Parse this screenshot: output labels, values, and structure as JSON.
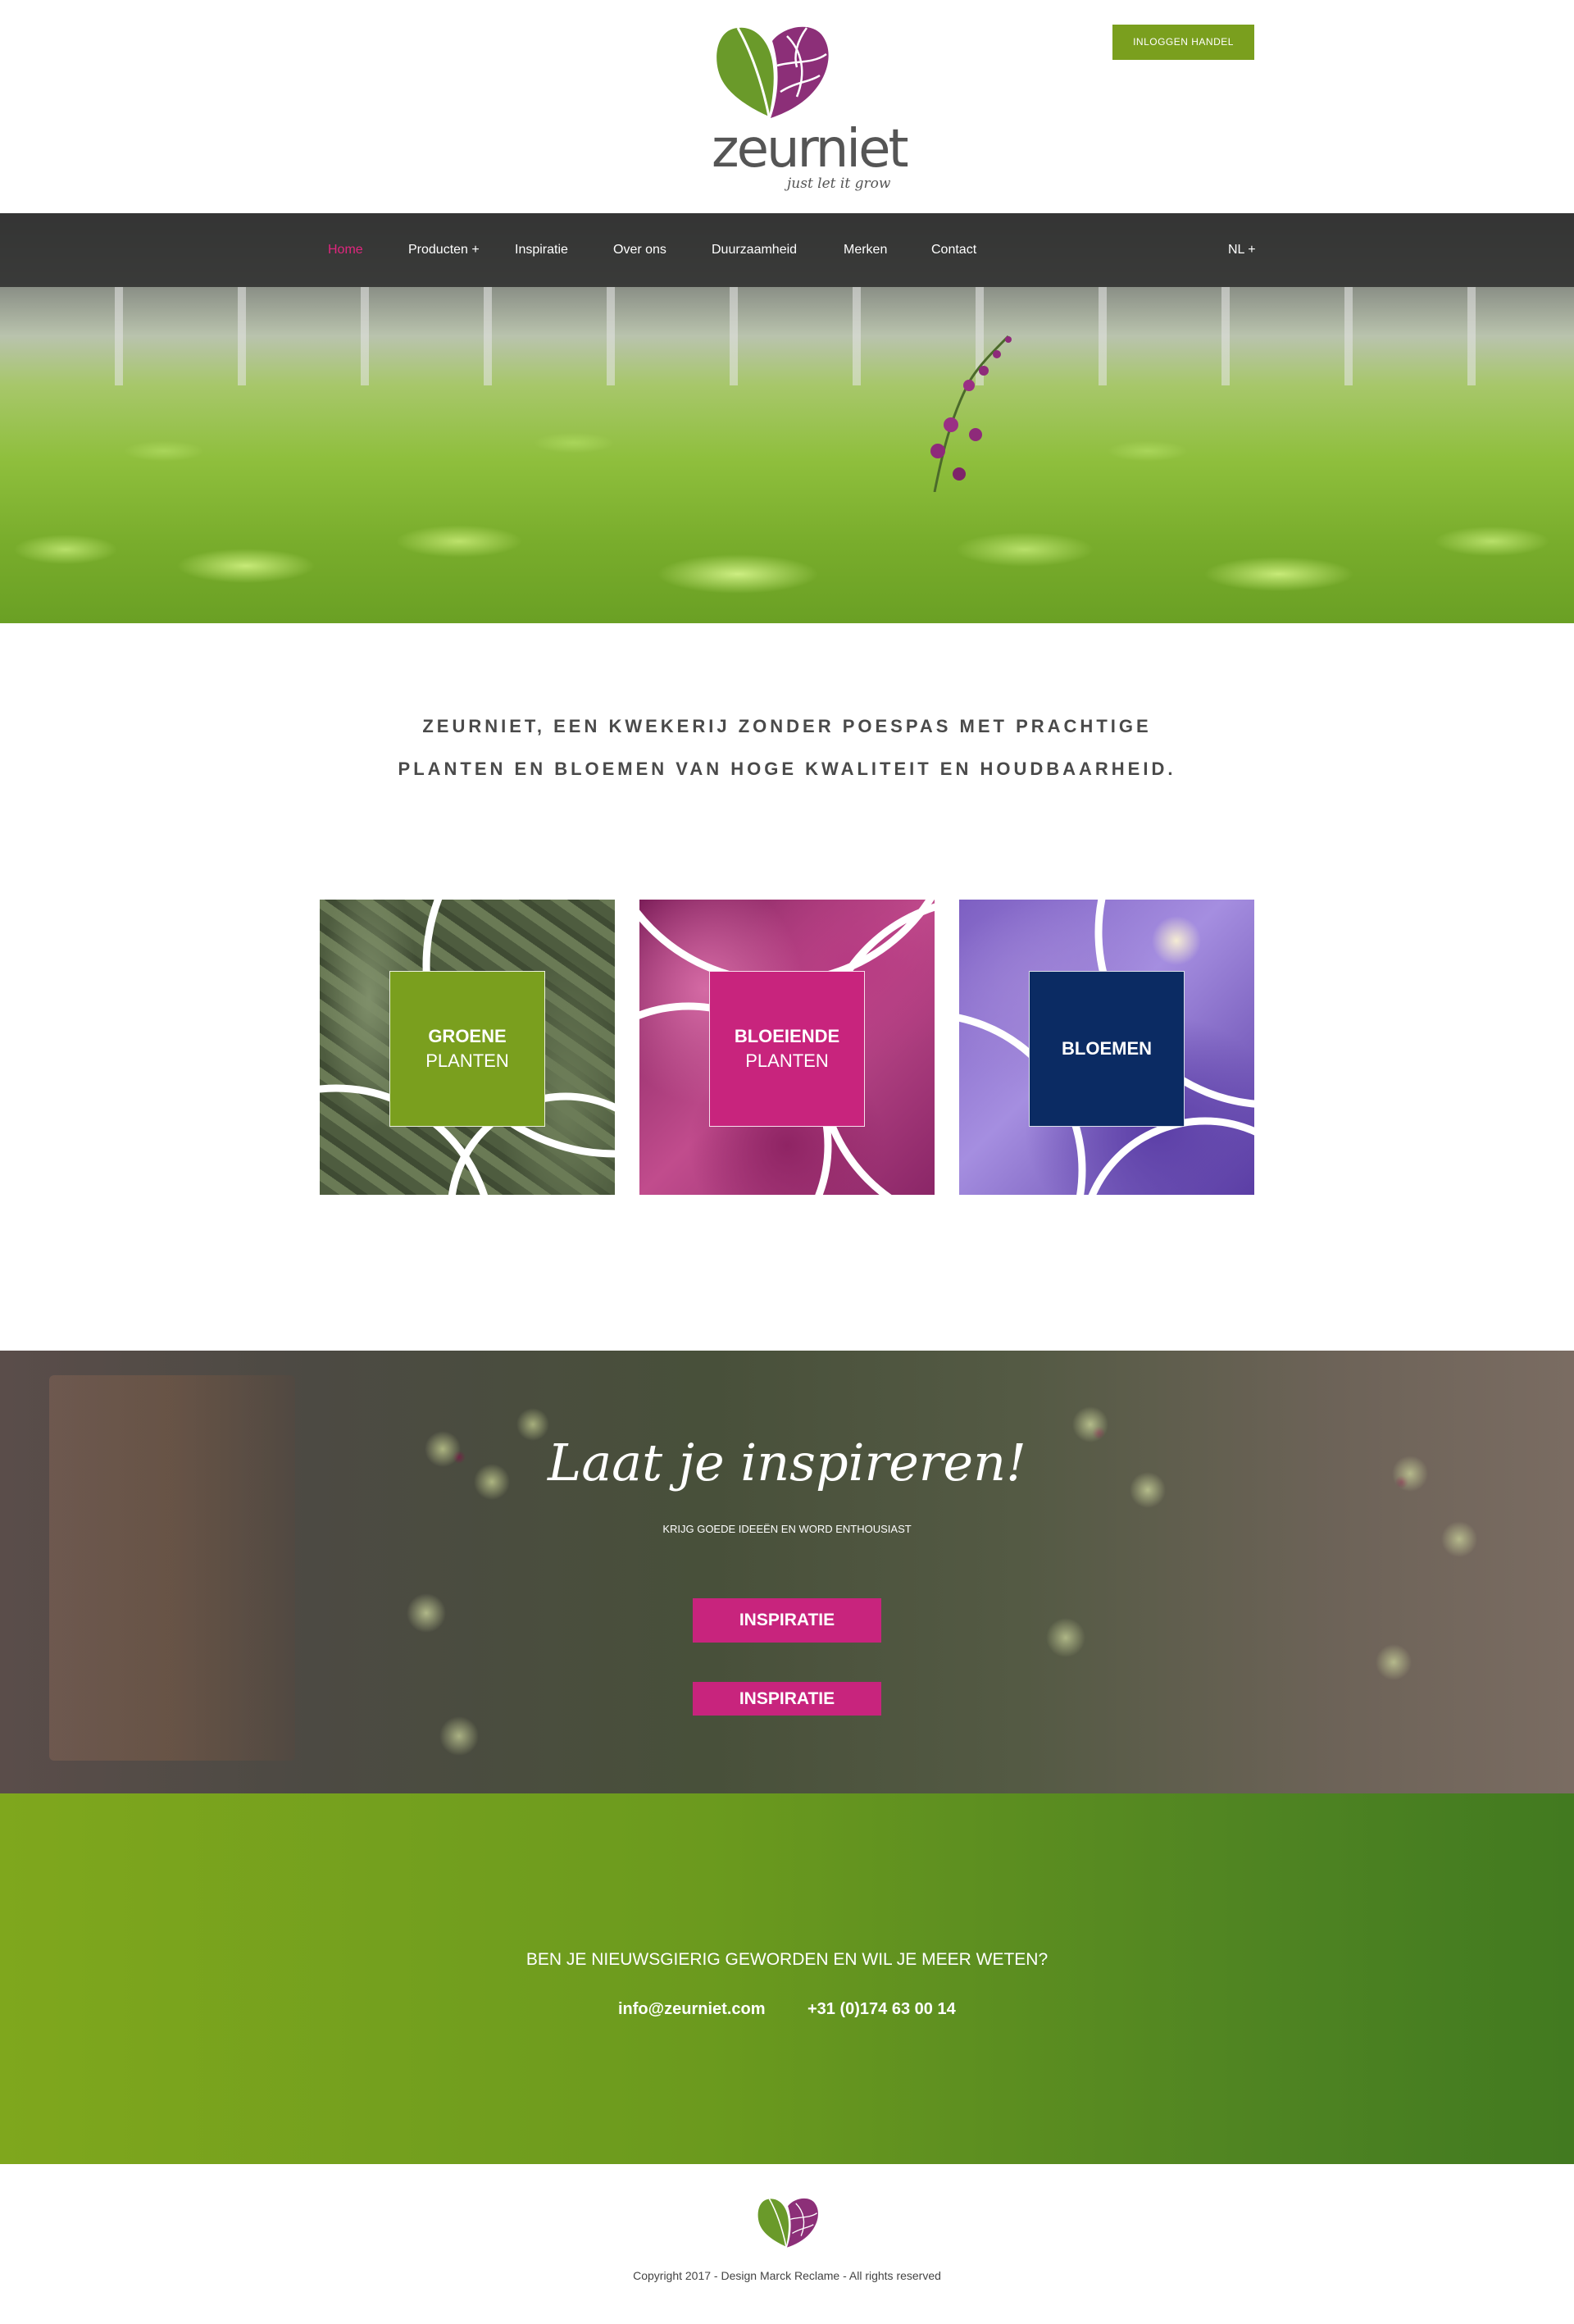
{
  "header": {
    "logo_word": "zeurniet",
    "logo_tagline": "just let it grow",
    "login_button": "INLOGGEN HANDEL"
  },
  "nav": {
    "items": [
      {
        "label": "Home",
        "active": true
      },
      {
        "label": "Producten +"
      },
      {
        "label": "Inspiratie"
      },
      {
        "label": "Over ons"
      },
      {
        "label": "Duurzaamheid"
      },
      {
        "label": "Merken"
      },
      {
        "label": "Contact"
      }
    ],
    "language": "NL +"
  },
  "intro": {
    "line1": "ZEURNIET, EEN KWEKERIJ ZONDER POESPAS MET PRACHTIGE",
    "line2": "PLANTEN EN BLOEMEN VAN HOGE KWALITEIT EN HOUDBAARHEID."
  },
  "tiles": [
    {
      "line1": "GROENE",
      "line2": "PLANTEN",
      "color": "#7a9f1e"
    },
    {
      "line1": "BLOEIENDE",
      "line2": "PLANTEN",
      "color": "#c8247d"
    },
    {
      "line1": "BLOEMEN",
      "line2": "",
      "color": "#0b2b63"
    }
  ],
  "inspiration": {
    "title": "Laat je inspireren!",
    "subtitle": "KRIJG GOEDE IDEEËN EN WORD ENTHOUSIAST",
    "button_primary": "INSPIRATIE",
    "button_secondary": "INSPIRATIE"
  },
  "contact": {
    "question": "BEN JE NIEUWSGIERIG GEWORDEN EN WIL JE MEER WETEN?",
    "email": "info@zeurniet.com",
    "phone": "+31 (0)174 63 00 14"
  },
  "footer": {
    "copyright": "Copyright 2017 - Design Marck Reclame - All rights reserved"
  },
  "colors": {
    "brand_green": "#7a9f1e",
    "brand_magenta": "#c8247d",
    "brand_navy": "#0b2b63",
    "nav_active": "#e0267e"
  }
}
